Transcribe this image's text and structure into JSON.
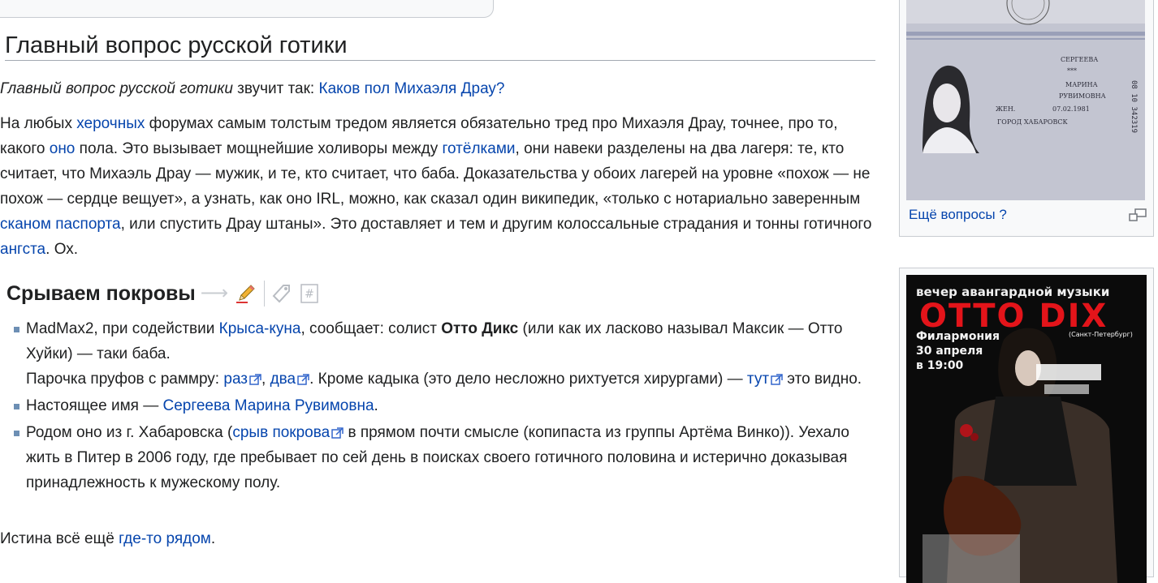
{
  "section": {
    "title": "Главный вопрос русской готики"
  },
  "intro": {
    "italic": "Главный вопрос русской готики",
    "text": " звучит так: ",
    "link": "Каков пол Михаэля Драу?"
  },
  "para": {
    "t1": "На любых ",
    "l1": "херочных",
    "t2": " форумах самым толстым тредом является обязательно тред про Михаэля Драу, точнее, про то, какого ",
    "l2": "оно",
    "t3": " пола. Это вызывает мощнейшие холиворы между ",
    "l3": "готёлками",
    "t4": ", они навеки разделены на два лагеря: те, кто считает, что Михаэль Драу — мужик, и те, кто считает, что баба. Доказательства у обоих лагерей на уровне «похож — не похож — сердце вещует», а узнать, как оно IRL, можно, как сказал один википедик, «только с нотариально заверенным ",
    "l4": "сканом паспорта",
    "t5": ", или спустить Драу штаны». Это доставляет и тем и другим колоссальные страдания и тонны готичного ",
    "l5": "ангста",
    "t6": ". Ох."
  },
  "subsection": {
    "title": "Срываем покровы",
    "arrow": "⟶"
  },
  "items": {
    "i1": {
      "t1": "MadMax2, при содействии ",
      "l1": "Крыса-куна",
      "t2": ", сообщает: солист ",
      "b1": "Отто Дикс",
      "t3": " (или как их ласково называл Максик — Отто Хуйки) — таки баба.",
      "t4": "Парочка пруфов с раммру: ",
      "l2": "раз",
      "t5": ", ",
      "l3": "два",
      "t6": ". Кроме кадыка (это дело несложно рихтуется хирургами) — ",
      "l4": "тут",
      "t7": " это видно."
    },
    "i2": {
      "t1": "Настоящее имя — ",
      "l1": "Сергеева Марина Рувимовна",
      "t2": "."
    },
    "i3": {
      "t1": "Родом оно из г. Хабаровска (",
      "l1": "срыв покрова",
      "t2": " в прямом почти смысле (копипаста из группы Артёма Винко)). Уехало жить в Питер в 2006 году, где пребывает по сей день в поисках своего готичного половина и истерично доказывая принадлежность к мужескому полу."
    }
  },
  "closing": {
    "t1": "Истина всё ещё ",
    "l1": "где-то рядом",
    "t2": "."
  },
  "sidebar": {
    "caption": "Ещё вопросы ?",
    "passport": {
      "surname": "СЕРГЕЕВА",
      "stars": "***",
      "name": "МАРИНА",
      "patronymic": "РУВИМОВНА",
      "sex": "ЖЕН.",
      "dob": "07.02.1981",
      "city": "ГОРОД ХАБАРОВСК",
      "number": "08 10 342319"
    },
    "poster": {
      "line1": "вечер авангардной музыки",
      "band": "OTTO DIX",
      "venue": "Филармония",
      "city": "(Санкт-Петербург)",
      "date": "30 апреля",
      "time": "в 19:00"
    }
  }
}
